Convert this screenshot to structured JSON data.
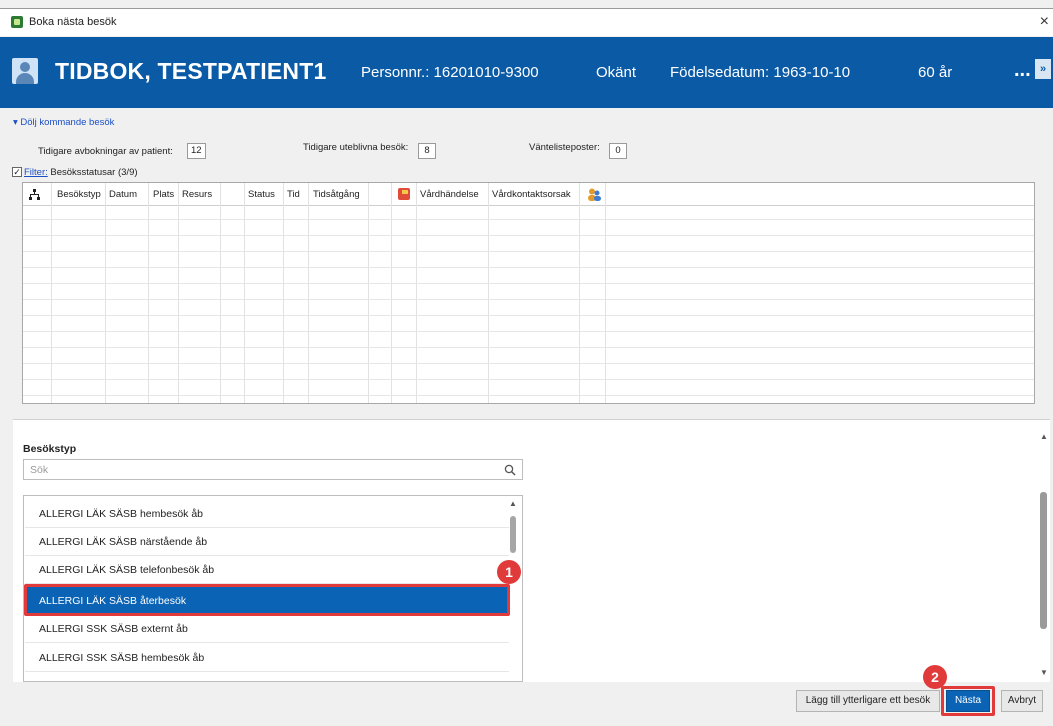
{
  "window": {
    "title": "Boka nästa besök",
    "close_glyph": "×"
  },
  "banner": {
    "patient_name": "TIDBOK, TESTPATIENT1",
    "personnr": "Personnr.: 16201010-9300",
    "gender": "Okänt",
    "birthdate": "Födelsedatum: 1963-10-10",
    "age": "60 år",
    "more": "...",
    "expand": "»",
    "background_color": "#0b5aa5"
  },
  "upcoming": {
    "collapse_link": "▾ Dölj kommande besök",
    "stats": [
      {
        "label": "Tidigare avbokningar av patient:",
        "value": "12"
      },
      {
        "label": "Tidigare uteblivna besök:",
        "value": "8"
      },
      {
        "label": "Väntelisteposter:",
        "value": "0"
      }
    ],
    "filter_link": "Filter:",
    "filter_value": "Besöksstatusar (3/9)",
    "checkbox_checked": "✓",
    "columns": [
      "Besökstyp",
      "Datum",
      "Plats",
      "Resurs",
      "Status",
      "Tid",
      "Tidsåtgång",
      "Vårdhändelse",
      "Vårdkontaktsorsak"
    ],
    "icons": [
      "tree-icon",
      "warning-icon",
      "people-icon"
    ]
  },
  "visit_type": {
    "title": "Besökstyp",
    "search_placeholder": "Sök",
    "items": [
      "ALLERGI LÄK SÄSB hembesök åb",
      "ALLERGI LÄK SÄSB närstående åb",
      "ALLERGI LÄK SÄSB telefonbesök åb",
      "ALLERGI LÄK SÄSB återbesök",
      "ALLERGI SSK SÄSB externt åb",
      "ALLERGI SSK SÄSB hembesök åb"
    ],
    "selected_index": 3,
    "selected_color": "#0a63b5"
  },
  "annotations": {
    "step1": "1",
    "step2": "2",
    "color": "#e03a3a"
  },
  "footer": {
    "add_more_label": "Lägg till ytterligare ett besök",
    "next_label": "Nästa",
    "cancel_label": "Avbryt"
  }
}
